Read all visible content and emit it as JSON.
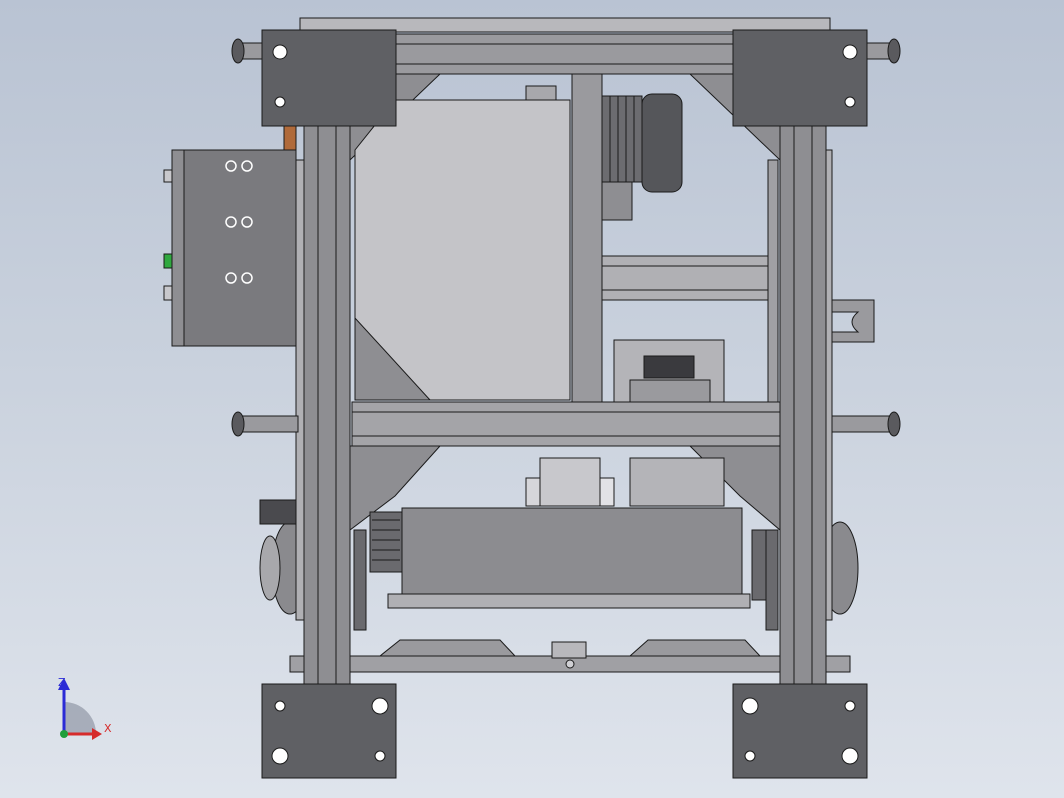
{
  "view": {
    "background_top": "#b9c3d3",
    "background_bottom": "#dfe4ec"
  },
  "model": {
    "frame_color": "#8e8e92",
    "dark_plate_color": "#5f6064",
    "light_panel_color": "#c4c4c8",
    "line_color": "#1a1a1a"
  },
  "triad": {
    "z_label": "Z",
    "x_label": "X",
    "z_color": "#2b2bd6",
    "x_color": "#d62b2b",
    "y_color": "#1f9e3a"
  }
}
